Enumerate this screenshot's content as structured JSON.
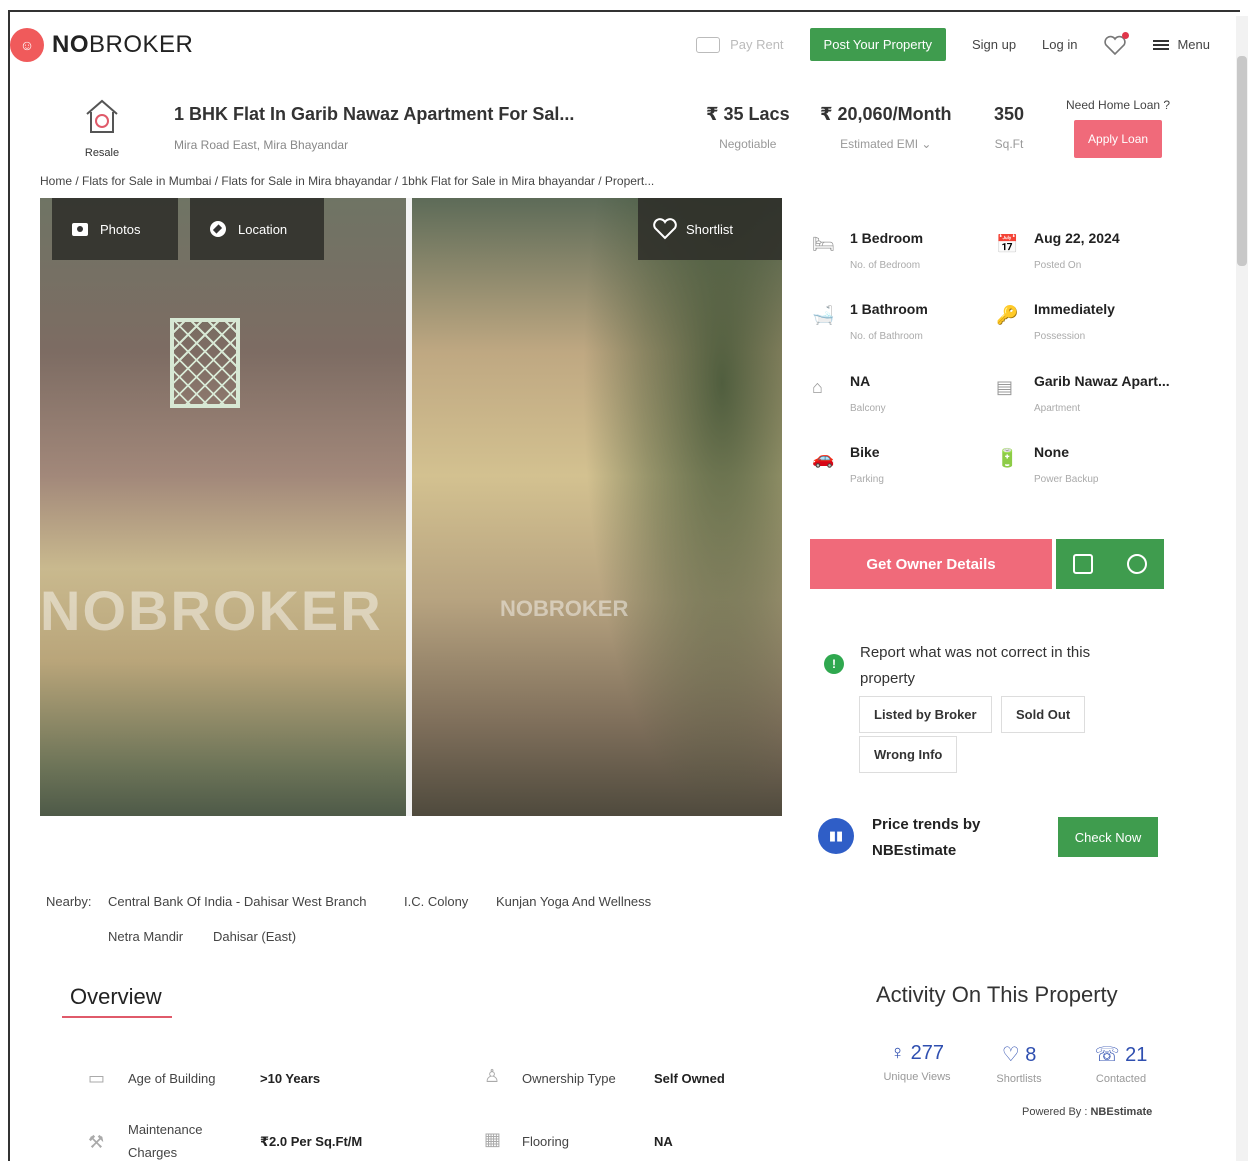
{
  "header": {
    "logo_no": "NO",
    "logo_broker": "BROKER",
    "pay_rent": "Pay Rent",
    "post_property": "Post Your Property",
    "sign_up": "Sign up",
    "log_in": "Log in",
    "menu": "Menu"
  },
  "summary": {
    "badge": "Resale",
    "title": "1 BHK Flat In Garib Nawaz Apartment For Sal...",
    "location": "Mira Road East, Mira Bhayandar",
    "price": "₹ 35 Lacs",
    "price_label": "Negotiable",
    "emi": "₹ 20,060/Month",
    "emi_label": "Estimated EMI ⌄",
    "area": "350",
    "area_label": "Sq.Ft",
    "loan_question": "Need Home Loan ?",
    "apply_loan": "Apply Loan"
  },
  "breadcrumb": "Home / Flats for Sale in Mumbai / Flats for Sale in Mira bhayandar / 1bhk Flat for Sale in Mira bhayandar / Propert...",
  "gallery": {
    "photos_tab": "Photos",
    "location_tab": "Location",
    "shortlist": "Shortlist",
    "watermark": "NOBROKER",
    "watermark_small": "NOBROKER"
  },
  "details": [
    {
      "value": "1 Bedroom",
      "label": "No. of Bedroom",
      "icon": "bed-icon"
    },
    {
      "value": "Aug 22, 2024",
      "label": "Posted On",
      "icon": "calendar-icon"
    },
    {
      "value": "1 Bathroom",
      "label": "No. of Bathroom",
      "icon": "bath-icon"
    },
    {
      "value": "Immediately",
      "label": "Possession",
      "icon": "key-icon"
    },
    {
      "value": "NA",
      "label": "Balcony",
      "icon": "balcony-icon"
    },
    {
      "value": "Garib Nawaz Apart...",
      "label": "Apartment",
      "icon": "building-icon"
    },
    {
      "value": "Bike",
      "label": "Parking",
      "icon": "car-icon"
    },
    {
      "value": "None",
      "label": "Power Backup",
      "icon": "battery-icon"
    }
  ],
  "actions": {
    "owner_details": "Get Owner Details"
  },
  "report": {
    "text": "Report what was not correct in this property",
    "chips": [
      "Listed by Broker",
      "Sold Out",
      "Wrong Info"
    ]
  },
  "trend": {
    "text_1": "Price trends by",
    "text_2": "NBEstimate",
    "button": "Check Now"
  },
  "nearby": {
    "label": "Nearby:",
    "items": [
      "Central Bank Of India - Dahisar West Branch",
      "I.C. Colony",
      "Kunjan Yoga And Wellness",
      "Netra Mandir",
      "Dahisar (East)"
    ]
  },
  "overview": {
    "title": "Overview",
    "rows": [
      {
        "label": "Age of Building",
        "value": ">10 Years"
      },
      {
        "label": "Ownership Type",
        "value": "Self Owned"
      },
      {
        "label_1": "Maintenance",
        "label_2": "Charges",
        "value": "₹2.0 Per Sq.Ft/M"
      },
      {
        "label": "Flooring",
        "value": "NA"
      }
    ]
  },
  "activity": {
    "title": "Activity On This Property",
    "views": "277",
    "views_label": "Unique Views",
    "shortlists": "8",
    "shortlists_label": "Shortlists",
    "contacted": "21",
    "contacted_label": "Contacted",
    "powered_by": "Powered By :",
    "powered_brand": "NBEstimate"
  },
  "colors": {
    "brand_red": "#f05a5b",
    "green": "#3f9c4e",
    "pink_btn": "#f06a7a",
    "blue": "#2f5ec7"
  }
}
